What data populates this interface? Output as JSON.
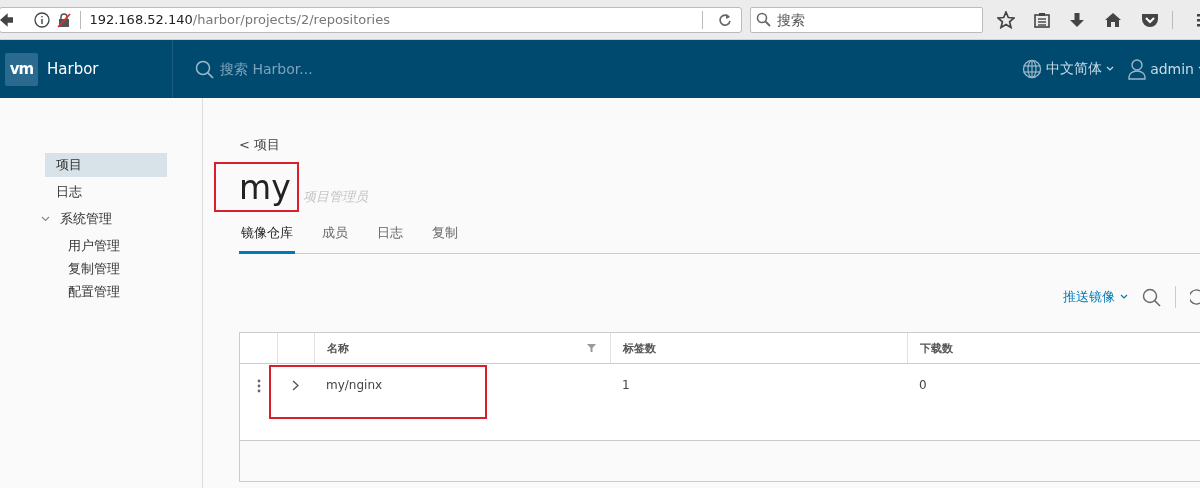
{
  "browser": {
    "url_host": "192.168.52.140",
    "url_path": "/harbor/projects/2/repositories",
    "search_placeholder": "搜索"
  },
  "header": {
    "logo_text": "vm",
    "brand": "Harbor",
    "search_placeholder": "搜索 Harbor...",
    "language": "中文简体",
    "user": "admin"
  },
  "sidebar": {
    "items": [
      {
        "label": "项目",
        "selected": true
      },
      {
        "label": "日志",
        "selected": false
      },
      {
        "label": "系统管理",
        "selected": false,
        "expanded": true,
        "children": [
          {
            "label": "用户管理",
            "selected": false
          },
          {
            "label": "复制管理",
            "selected": false
          },
          {
            "label": "配置管理",
            "selected": false
          }
        ]
      }
    ]
  },
  "project": {
    "back_link": "< 项目",
    "name": "my",
    "role": "项目管理员",
    "highlighted": true
  },
  "tabs": [
    {
      "label": "镜像仓库",
      "selected": true
    },
    {
      "label": "成员",
      "selected": false
    },
    {
      "label": "日志",
      "selected": false
    },
    {
      "label": "复制",
      "selected": false
    }
  ],
  "toolbar": {
    "push_button": "推送镜像"
  },
  "table": {
    "columns": [
      "名称",
      "标签数",
      "下载数"
    ],
    "rows": [
      {
        "name": "my/nginx",
        "tags": "1",
        "downloads": "0",
        "highlighted": true
      }
    ]
  }
}
